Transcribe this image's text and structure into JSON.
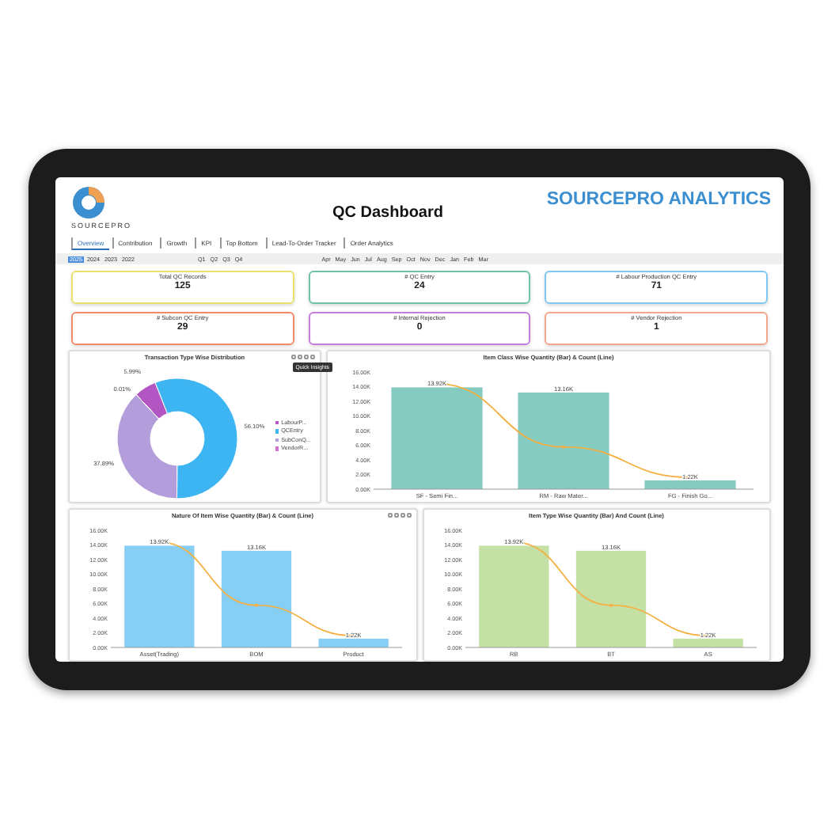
{
  "header": {
    "brand_mark": "SOURCEPRO",
    "title": "QC Dashboard",
    "brand": "SOURCEPRO ANALYTICS"
  },
  "tabs": [
    {
      "label": "Overview",
      "selected": true
    },
    {
      "label": "Contribution",
      "selected": false
    },
    {
      "label": "Growth",
      "selected": false
    },
    {
      "label": "KPI",
      "selected": false
    },
    {
      "label": "Top Bottom",
      "selected": false
    },
    {
      "label": "Lead-To-Order Tracker",
      "selected": false
    },
    {
      "label": "Order Analytics",
      "selected": false
    }
  ],
  "filters": {
    "years": [
      {
        "label": "2025",
        "selected": true
      },
      {
        "label": "2024",
        "selected": false
      },
      {
        "label": "2023",
        "selected": false
      },
      {
        "label": "2022",
        "selected": false
      }
    ],
    "quarters": [
      {
        "label": "Q1",
        "selected": false
      },
      {
        "label": "Q2",
        "selected": false
      },
      {
        "label": "Q3",
        "selected": false
      },
      {
        "label": "Q4",
        "selected": false
      }
    ],
    "months": [
      {
        "label": "Apr",
        "selected": false
      },
      {
        "label": "May",
        "selected": false
      },
      {
        "label": "Jun",
        "selected": false
      },
      {
        "label": "Jul",
        "selected": false
      },
      {
        "label": "Aug",
        "selected": false
      },
      {
        "label": "Sep",
        "selected": false
      },
      {
        "label": "Oct",
        "selected": false
      },
      {
        "label": "Nov",
        "selected": false
      },
      {
        "label": "Dec",
        "selected": false
      },
      {
        "label": "Jan",
        "selected": false
      },
      {
        "label": "Feb",
        "selected": false
      },
      {
        "label": "Mar",
        "selected": false
      }
    ]
  },
  "kpis": [
    {
      "label": "Total QC Records",
      "value": "125",
      "color": "#e8e26a"
    },
    {
      "label": "# QC Entry",
      "value": "24",
      "color": "#6cc4a4"
    },
    {
      "label": "# Labour Production QC Entry",
      "value": "71",
      "color": "#7cc8f0"
    },
    {
      "label": "# Subcon QC Entry",
      "value": "29",
      "color": "#f08a6a"
    },
    {
      "label": "# Internal Rejection",
      "value": "0",
      "color": "#c77ddc"
    },
    {
      "label": "# Vendor Rejection",
      "value": "1",
      "color": "#f4a58a"
    }
  ],
  "donut_card": {
    "tooltip": "Quick Insights",
    "legend": [
      {
        "color": "#b455c4"
      },
      {
        "color": "#3db5f2"
      },
      {
        "color": "#b39ddb"
      },
      {
        "color": "#d070d0"
      }
    ],
    "chart_data": {
      "type": "donut",
      "title": "Transaction Type Wise Distribution",
      "categories": [
        "LabourP...",
        "QCEntry",
        "SubConQ...",
        "VendorR..."
      ],
      "values": [
        5.99,
        56.1,
        37.89,
        0.01
      ],
      "value_labels": [
        "5.99%",
        "56.10%",
        "37.89%",
        "0.01%"
      ]
    }
  },
  "bar_charts": [
    {
      "chart_data": {
        "type": "bar",
        "title": "Item Class Wise Quantity (Bar) & Count (Line)",
        "categories": [
          "SF - Semi Fin...",
          "RM - Raw Mater...",
          "FG - Finish Go..."
        ],
        "series": [
          {
            "color": "#86cbc0",
            "values": [
              13900,
              13200,
              1200
            ]
          }
        ],
        "ylim": [
          0,
          16000
        ],
        "yticks": [
          {
            "value": 0,
            "label": "0.00K"
          },
          {
            "value": 2000,
            "label": "2.00K"
          },
          {
            "value": 4000,
            "label": "4.00K"
          },
          {
            "value": 6000,
            "label": "6.00K"
          },
          {
            "value": 8000,
            "label": "8.00K"
          },
          {
            "value": 10000,
            "label": "10.00K"
          },
          {
            "value": 12000,
            "label": "12.00K"
          },
          {
            "value": 14000,
            "label": "14.00K"
          },
          {
            "value": 16000,
            "label": "16.00K"
          }
        ],
        "value_labels": [
          "13.92K",
          "13.16K",
          "1.22K"
        ]
      }
    },
    {
      "chart_data": {
        "type": "bar",
        "title": "Nature Of Item Wise Quantity (Bar) & Count (Line)",
        "categories": [
          "Asset(Trading)",
          "BOM",
          "Product"
        ],
        "series": [
          {
            "color": "#87cef5",
            "values": [
              13900,
              13200,
              1200
            ]
          }
        ],
        "ylim": [
          0,
          16000
        ],
        "yticks": [
          {
            "value": 0,
            "label": "0.00K"
          },
          {
            "value": 2000,
            "label": "2.00K"
          },
          {
            "value": 4000,
            "label": "4.00K"
          },
          {
            "value": 6000,
            "label": "6.00K"
          },
          {
            "value": 8000,
            "label": "8.00K"
          },
          {
            "value": 10000,
            "label": "10.00K"
          },
          {
            "value": 12000,
            "label": "12.00K"
          },
          {
            "value": 14000,
            "label": "14.00K"
          },
          {
            "value": 16000,
            "label": "16.00K"
          }
        ],
        "value_labels": [
          "13.92K",
          "13.16K",
          "1.22K"
        ]
      }
    },
    {
      "chart_data": {
        "type": "bar",
        "title": "Item Type Wise Quantity (Bar) And Count (Line)",
        "categories": [
          "RB",
          "BT",
          "AS"
        ],
        "series": [
          {
            "color": "#c5e0a5",
            "values": [
              13900,
              13200,
              1200
            ]
          }
        ],
        "ylim": [
          0,
          16000
        ],
        "yticks": [
          {
            "value": 0,
            "label": "0.00K"
          },
          {
            "value": 2000,
            "label": "2.00K"
          },
          {
            "value": 4000,
            "label": "4.00K"
          },
          {
            "value": 6000,
            "label": "6.00K"
          },
          {
            "value": 8000,
            "label": "8.00K"
          },
          {
            "value": 10000,
            "label": "10.00K"
          },
          {
            "value": 12000,
            "label": "12.00K"
          },
          {
            "value": 14000,
            "label": "14.00K"
          },
          {
            "value": 16000,
            "label": "16.00K"
          }
        ],
        "value_labels": [
          "13.92K",
          "13.16K",
          "1.22K"
        ]
      }
    }
  ]
}
